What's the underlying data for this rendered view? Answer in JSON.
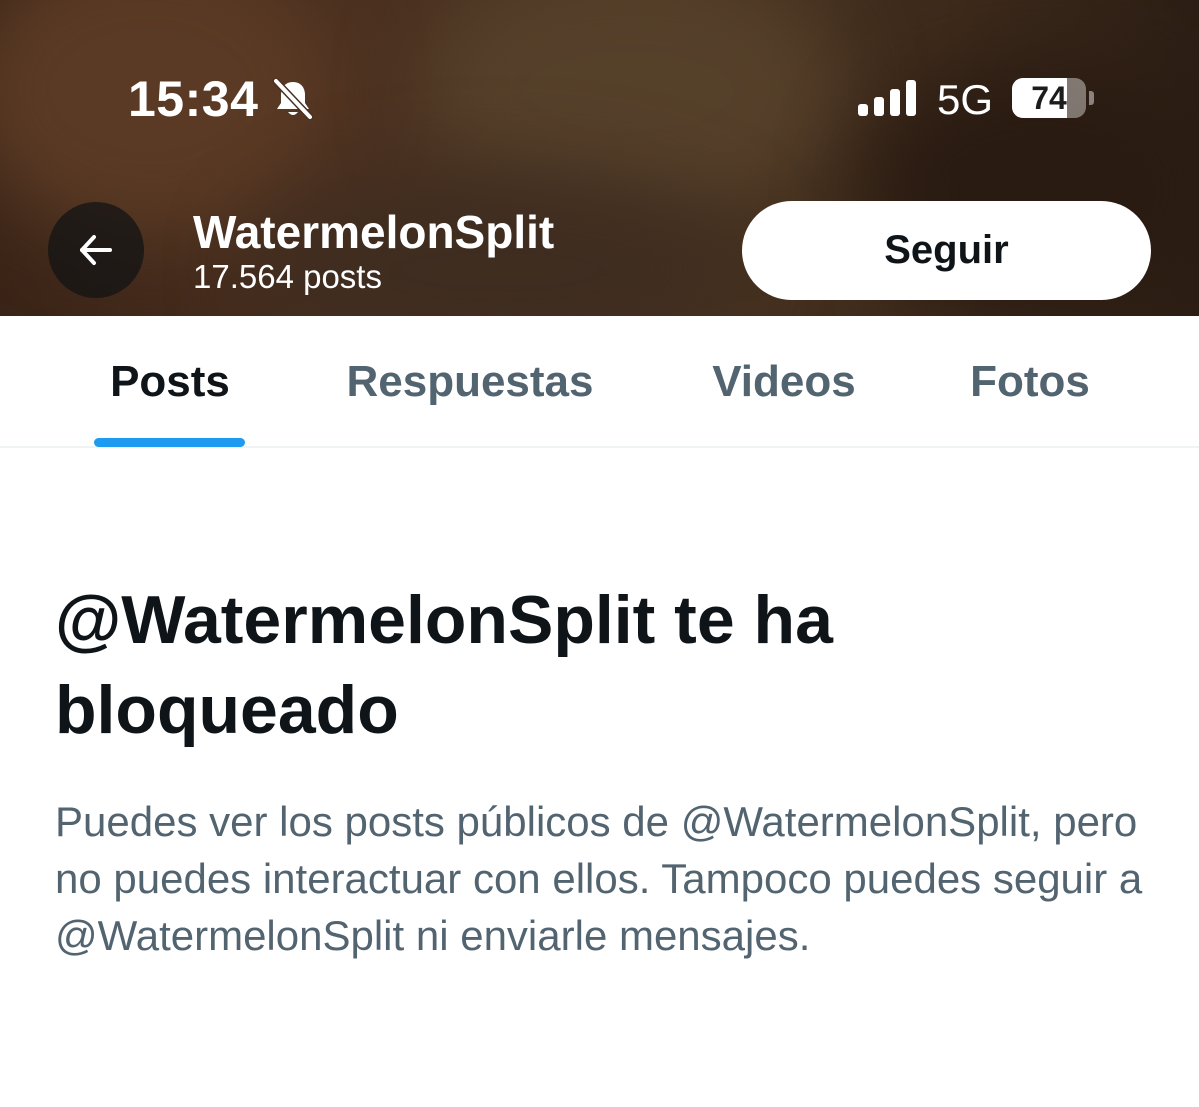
{
  "status_bar": {
    "time": "15:34",
    "silent_icon": "bell-slash-icon",
    "signal_icon": "cellular-signal-icon",
    "network": "5G",
    "battery_level": "74",
    "battery_fraction": 0.74
  },
  "header": {
    "back_icon": "arrow-left-icon",
    "name": "WatermelonSplit",
    "posts_count": "17.564 posts",
    "follow_label": "Seguir"
  },
  "tabs": [
    {
      "label": "Posts",
      "active": true
    },
    {
      "label": "Respuestas",
      "active": false
    },
    {
      "label": "Videos",
      "active": false
    },
    {
      "label": "Fotos",
      "active": false
    }
  ],
  "blocked": {
    "title": "@WatermelonSplit te ha bloqueado",
    "description": "Puedes ver los posts públicos de @WatermelonSplit, pero no puedes interactuar con ellos. Tampoco puedes seguir a @WatermelonSplit ni enviarle mensajes."
  },
  "colors": {
    "accent": "#1d9bf0",
    "text_primary": "#0f1419",
    "text_secondary": "#536471"
  }
}
